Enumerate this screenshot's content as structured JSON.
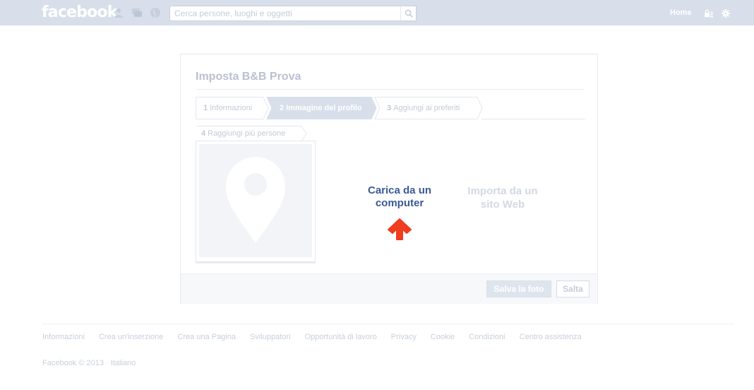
{
  "header": {
    "logo": "facebook",
    "search": {
      "placeholder": "Cerca persone, luoghi e oggetti",
      "value": ""
    },
    "home_label": "Home"
  },
  "dialog": {
    "title": "Imposta B&B Prova",
    "steps": [
      {
        "num": "1",
        "label": "Informazioni",
        "active": false
      },
      {
        "num": "2",
        "label": "Immagine del profilo",
        "active": true
      },
      {
        "num": "3",
        "label": "Aggiungi ai preferiti",
        "active": false
      },
      {
        "num": "4",
        "label": "Raggiungi più persone",
        "active": false
      }
    ],
    "upload_label": "Carica da un computer",
    "import_label": "Importa da un sito Web",
    "save_button": "Salva la foto",
    "skip_button": "Salta"
  },
  "footer": {
    "links": [
      "Informazioni",
      "Crea un'inserzione",
      "Crea una Pagina",
      "Sviluppatori",
      "Opportunità di lavoro",
      "Privacy",
      "Cookie",
      "Condizioni",
      "Centro assistenza"
    ],
    "copyright": "Facebook © 2013 · Italiano"
  },
  "colors": {
    "topbar": "#d8dfea",
    "brand_blue": "#3b5998",
    "active_step": "#d8dfea",
    "arrow": "#f03c1f"
  },
  "icons": {
    "friend_requests": "friends-icon",
    "messages": "messages-icon",
    "notifications": "globe-icon",
    "search": "magnifier-icon",
    "privacy": "lock-icon",
    "settings": "gear-icon",
    "placeholder": "map-pin-icon",
    "upload": "up-arrow-icon"
  }
}
